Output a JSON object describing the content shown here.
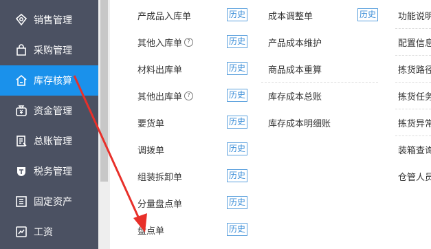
{
  "sidebar": {
    "items": [
      {
        "label": "销售管理",
        "icon": "sales-icon"
      },
      {
        "label": "采购管理",
        "icon": "purchase-icon"
      },
      {
        "label": "库存核算",
        "icon": "inventory-icon"
      },
      {
        "label": "资金管理",
        "icon": "money-icon"
      },
      {
        "label": "总账管理",
        "icon": "ledger-icon"
      },
      {
        "label": "税务管理",
        "icon": "tax-icon"
      },
      {
        "label": "固定资产",
        "icon": "asset-icon"
      },
      {
        "label": "工资",
        "icon": "salary-icon"
      }
    ],
    "active_index": 2,
    "active_color": "#1a91eb",
    "bg_color": "#4b5162"
  },
  "column1": [
    {
      "label": "产成品入库单",
      "history": "历史"
    },
    {
      "label": "其他入库单",
      "history": "历史",
      "help": "?"
    },
    {
      "label": "材料出库单",
      "history": "历史"
    },
    {
      "label": "其他出库单",
      "history": "历史",
      "help": "?"
    },
    {
      "label": "要货单",
      "history": "历史"
    },
    {
      "label": "调拨单",
      "history": "历史"
    },
    {
      "label": "组装拆卸单",
      "history": "历史"
    },
    {
      "label": "分量盘点单",
      "history": "历史"
    },
    {
      "label": "盘点单",
      "history": "历史"
    }
  ],
  "column2": [
    {
      "label": "成本调整单",
      "history": "历史"
    },
    {
      "label": "产品成本维护"
    },
    {
      "label": "商品成本重算"
    },
    {
      "label": "库存成本总账"
    },
    {
      "label": "库存成本明细账"
    }
  ],
  "column3": [
    {
      "label": "功能说明"
    },
    {
      "label": "配置信息"
    },
    {
      "label": "拣货路径"
    },
    {
      "label": "拣货任务"
    },
    {
      "label": "拣货异常"
    },
    {
      "label": "装箱查询"
    },
    {
      "label": "仓管人员"
    }
  ],
  "annotation": {
    "arrow_color": "#e8302a"
  }
}
